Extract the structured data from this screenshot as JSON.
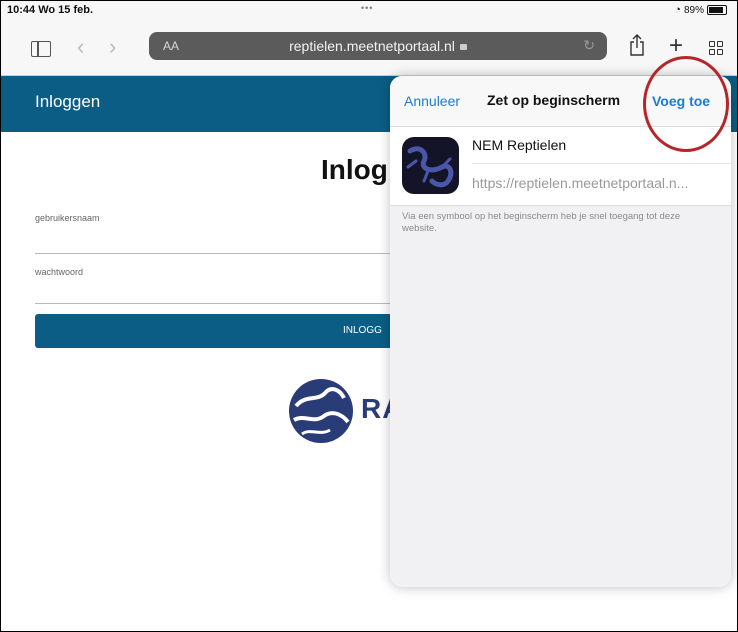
{
  "status_bar": {
    "time_date": "10:44  Wo 15 feb.",
    "dots": "•••",
    "battery_percent": "89%"
  },
  "browser": {
    "text_size_label": "AA",
    "url": "reptielen.meetnetportaal.nl",
    "icons": [
      "sidebar-icon",
      "back-icon",
      "forward-icon",
      "lock-icon",
      "reload-icon",
      "share-icon",
      "plus-icon",
      "tabs-icon"
    ]
  },
  "page": {
    "header_title": "Inloggen",
    "title": "Inlog",
    "username_label": "gebruikersnaam",
    "password_label": "wachtwoord",
    "login_button": "INLOGG",
    "logo_text": "RA"
  },
  "sheet": {
    "cancel_label": "Annuleer",
    "title": "Zet op beginscherm",
    "add_label": "Voeg toe",
    "app_name": "NEM Reptielen",
    "app_url": "https://reptielen.meetnetportaal.n...",
    "note": "Via een symbool op het beginscherm heb je snel toegang tot deze website."
  },
  "colors": {
    "brand_blue": "#0b5d85",
    "ios_link": "#1e7ad6",
    "highlight_ring": "#b5262a"
  }
}
